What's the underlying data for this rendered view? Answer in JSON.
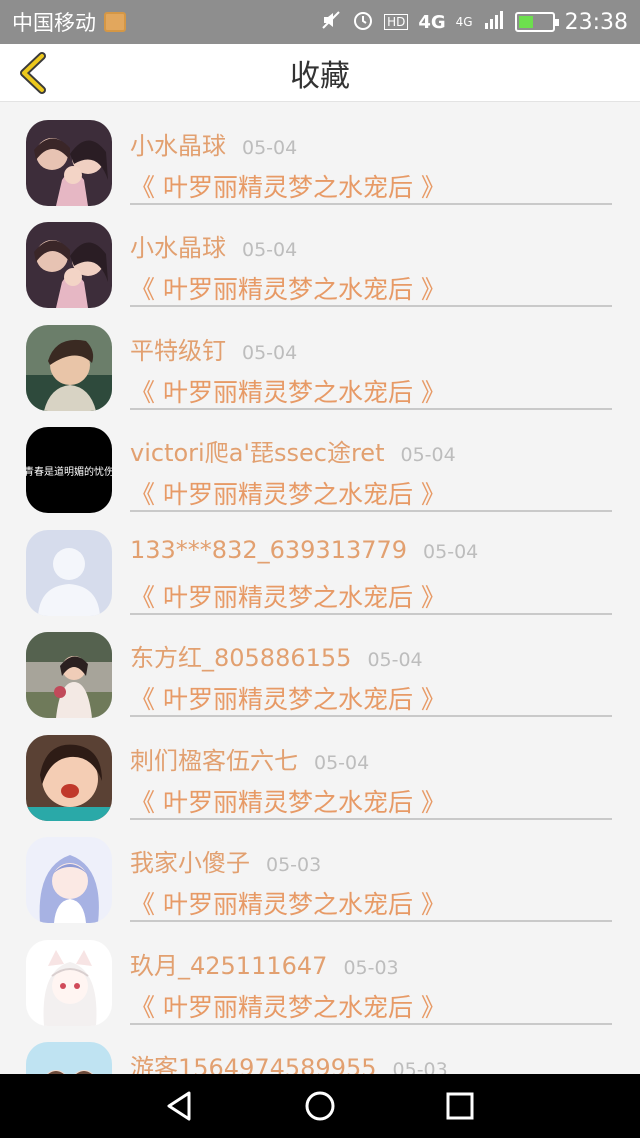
{
  "status_bar": {
    "carrier": "中国移动",
    "hd": "HD",
    "network1": "4G",
    "network2": "4G",
    "time": "23:38"
  },
  "nav": {
    "title": "收藏"
  },
  "items": [
    {
      "name": "小水晶球",
      "date": "05-04",
      "book": "《 叶罗丽精灵梦之水宠后 》"
    },
    {
      "name": "小水晶球",
      "date": "05-04",
      "book": "《 叶罗丽精灵梦之水宠后 》"
    },
    {
      "name": "平特级钉",
      "date": "05-04",
      "book": "《 叶罗丽精灵梦之水宠后 》"
    },
    {
      "name": "victori爬a'琵ssec途ret",
      "date": "05-04",
      "book": "《 叶罗丽精灵梦之水宠后 》",
      "avatar_text": "青春是道明媚的忧伤"
    },
    {
      "name": "133***832_639313779",
      "date": "05-04",
      "book": "《 叶罗丽精灵梦之水宠后 》"
    },
    {
      "name": "东方红_805886155",
      "date": "05-04",
      "book": "《 叶罗丽精灵梦之水宠后 》"
    },
    {
      "name": "刺们楹客伍六七",
      "date": "05-04",
      "book": "《 叶罗丽精灵梦之水宠后 》"
    },
    {
      "name": "我家小傻子",
      "date": "05-03",
      "book": "《 叶罗丽精灵梦之水宠后 》"
    },
    {
      "name": "玖月_425111647",
      "date": "05-03",
      "book": "《 叶罗丽精灵梦之水宠后 》"
    },
    {
      "name": "游客1564974589955",
      "date": "05-03",
      "book": ""
    }
  ],
  "colors": {
    "accent_name": "#e2a070",
    "accent_book": "#e79a66",
    "back_arrow": "#e8c31a",
    "status_bar": "#8e8e8e"
  }
}
